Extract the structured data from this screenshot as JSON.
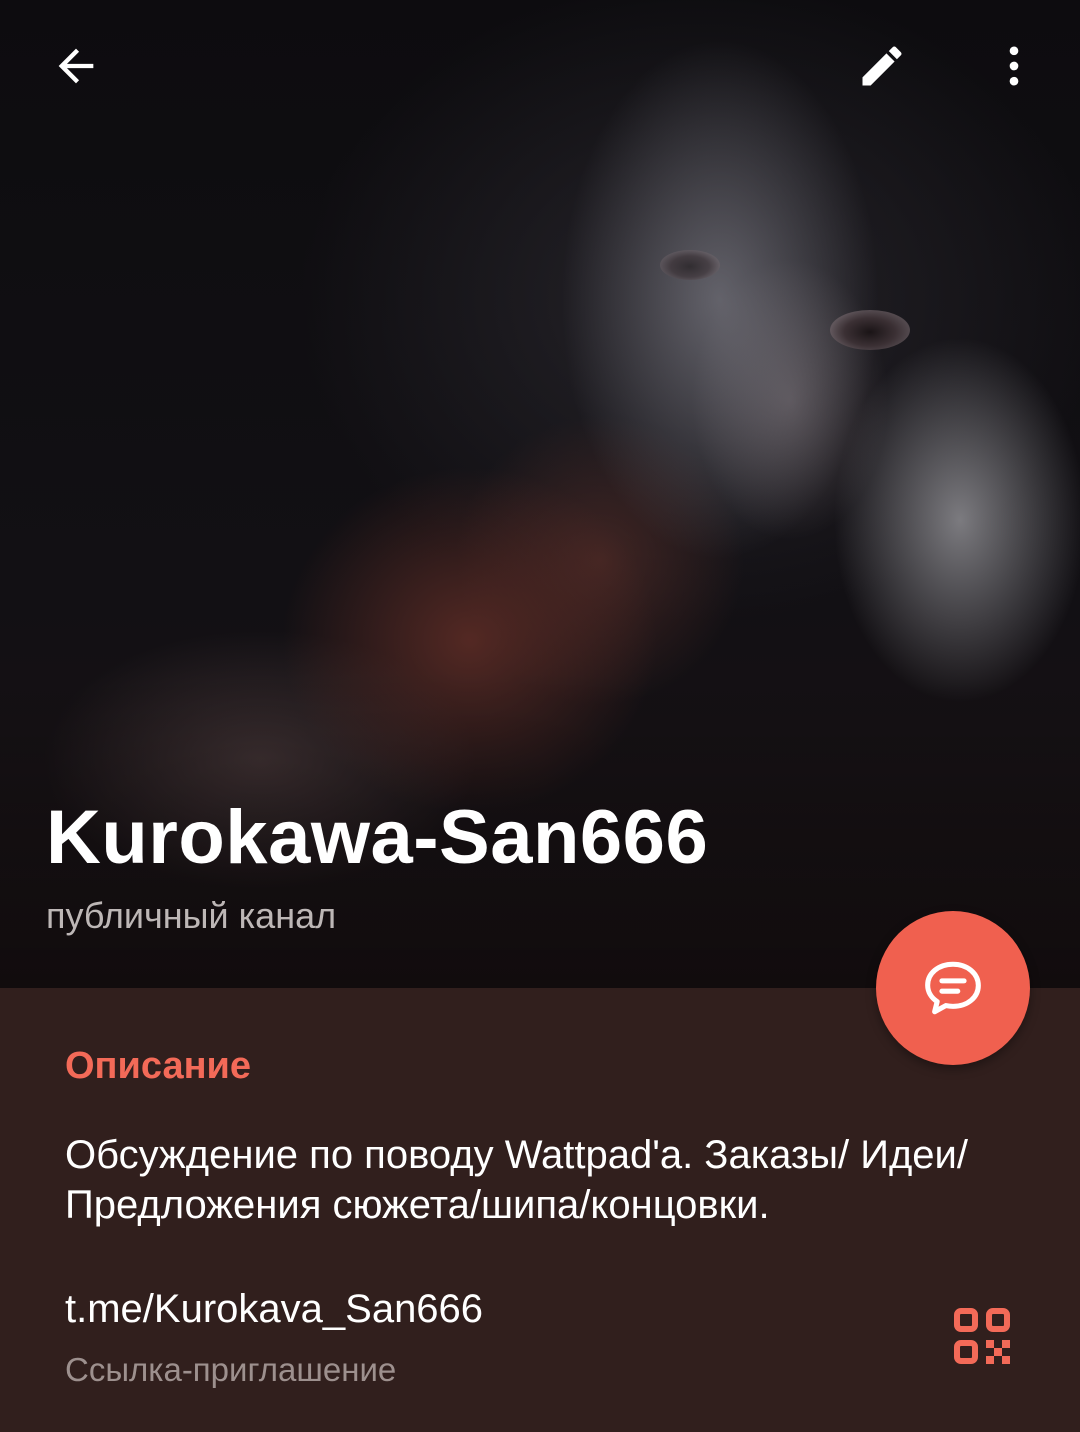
{
  "header": {
    "back_icon": "arrow-left-icon",
    "edit_icon": "pencil-icon",
    "more_icon": "more-vertical-icon",
    "title": "Kurokawa-San666",
    "subtitle": "публичный канал"
  },
  "fab": {
    "icon": "chat-bubble-icon",
    "color": "#f0604f"
  },
  "info": {
    "description_label": "Описание",
    "description_text": "Обсуждение по поводу Wattpad'a. Заказы/ Идеи/Предложения сюжета/шипа/концовки.",
    "link": "t.me/Kurokava_San666",
    "link_caption": "Ссылка-приглашение",
    "qr_icon": "qr-code-icon"
  },
  "colors": {
    "accent": "#f36a58",
    "panel_background": "#311f1d",
    "secondary_text": "#9d908e"
  }
}
